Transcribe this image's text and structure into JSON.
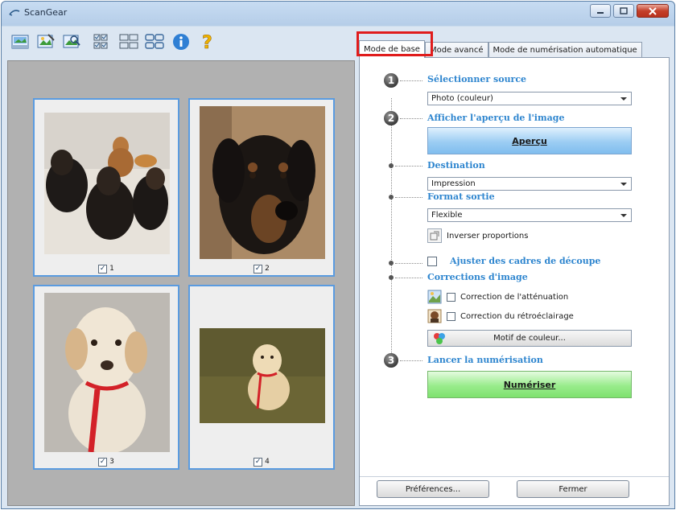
{
  "window": {
    "title": "ScanGear"
  },
  "toolbar": {
    "icons": [
      "scan-preview-icon",
      "crop-icon",
      "zoom-icon",
      "thumbnail-view-icon",
      "whole-image-view-icon",
      "select-all-icon",
      "info-icon",
      "help-icon"
    ]
  },
  "thumbnails": [
    {
      "label": "1",
      "checked": true,
      "check_mark": "✓"
    },
    {
      "label": "2",
      "checked": true,
      "check_mark": "✓"
    },
    {
      "label": "3",
      "checked": true,
      "check_mark": "✓"
    },
    {
      "label": "4",
      "checked": true,
      "check_mark": "✓"
    }
  ],
  "tabs": [
    {
      "label": "Mode de base",
      "active": true
    },
    {
      "label": "Mode avancé",
      "active": false
    },
    {
      "label": "Mode de numérisation automatique",
      "active": false
    }
  ],
  "steps": {
    "one": "1",
    "two": "2",
    "three": "3"
  },
  "basic": {
    "select_source_heading": "Sélectionner source",
    "source_value": "Photo (couleur)",
    "preview_heading": "Afficher l'aperçu de l'image",
    "preview_button": "Aperçu",
    "destination_heading": "Destination",
    "destination_value": "Impression",
    "output_size_heading": "Format sortie",
    "output_size_value": "Flexible",
    "invert_label": "Inverser proportions",
    "adjust_frames_label": "Ajuster des cadres de découpe",
    "corrections_heading": "Corrections d'image",
    "fading_label": "Correction de l'atténuation",
    "backlight_label": "Correction du rétroéclairage",
    "color_pattern_button": "Motif de couleur...",
    "start_scan_heading": "Lancer la numérisation",
    "scan_button": "Numériser"
  },
  "footer": {
    "preferences_button": "Préférences...",
    "close_button": "Fermer"
  },
  "colors": {
    "accent": "#2f86cf",
    "highlight": "#e01c1c",
    "preview_button": "#9ccdf3",
    "scan_button": "#99ec8c"
  }
}
